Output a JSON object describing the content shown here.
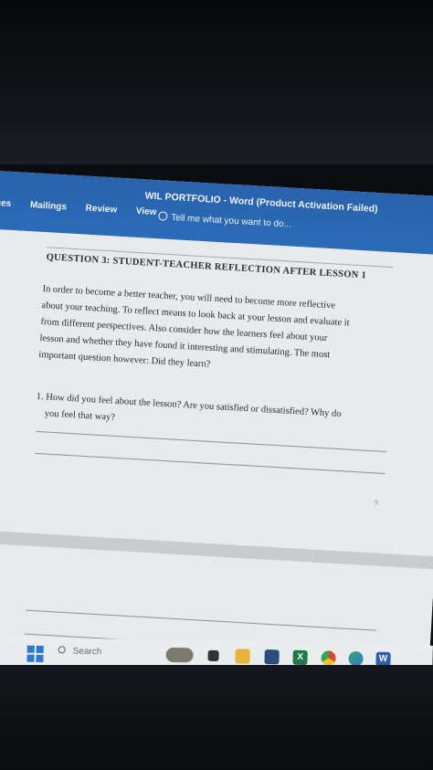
{
  "window": {
    "title": "WIL PORTFOLIO - Word (Product Activation Failed)"
  },
  "ribbon": {
    "tabs": [
      "ences",
      "Mailings",
      "Review",
      "View"
    ],
    "tell_me": "Tell me what you want to do..."
  },
  "document": {
    "heading": "QUESTION 3: STUDENT-TEACHER REFLECTION AFTER LESSON 1",
    "paragraph_lines": [
      "In order to become a better teacher, you will need to become more reflective",
      "about your teaching. To reflect means to look back at your lesson and evaluate it",
      "from different perspectives. Also consider how the learners feel about your",
      "lesson and whether they have found it interesting and stimulating. The most",
      "important question however: Did they learn?"
    ],
    "question_lines": [
      "1. How did you feel about the lesson? Are you satisfied or dissatisfied? Why do",
      "you feel that way?"
    ],
    "page_number": "9"
  },
  "taskbar": {
    "search_placeholder": "Search",
    "excel_letter": "X",
    "word_letter": "W"
  },
  "colors": {
    "ribbon": "#2b67b4",
    "page": "#e9eaec",
    "taskbar": "#ebeced"
  },
  "icons": [
    "lightbulb-icon",
    "windows-start-icon",
    "search-icon",
    "widget-icon",
    "task-view-icon",
    "file-explorer-icon",
    "store-icon",
    "excel-icon",
    "chrome-icon",
    "edge-icon",
    "word-icon"
  ]
}
